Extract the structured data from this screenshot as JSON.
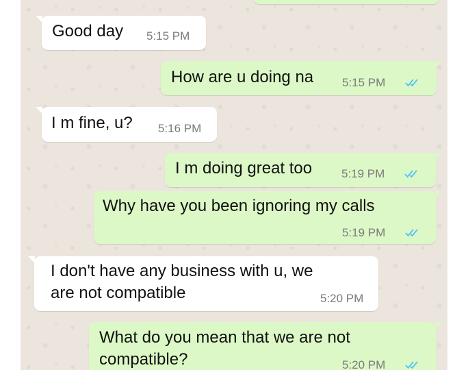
{
  "colors": {
    "chat_background": "#ece5dd",
    "incoming_bubble": "#ffffff",
    "outgoing_bubble": "#dcf8c6",
    "read_receipt": "#4fc3f7",
    "timestamp": "#7b7b7b"
  },
  "messages": [
    {
      "direction": "incoming",
      "text": "Good day",
      "time": "5:15 PM"
    },
    {
      "direction": "outgoing",
      "text": "How are u doing na",
      "time": "5:15 PM",
      "status_icon": "double-check-read-icon"
    },
    {
      "direction": "incoming",
      "text": "I m fine, u?",
      "time": "5:16 PM"
    },
    {
      "direction": "outgoing",
      "text": "I m doing great too",
      "time": "5:19 PM",
      "status_icon": "double-check-read-icon"
    },
    {
      "direction": "outgoing",
      "text": "Why have you been ignoring my calls",
      "time": "5:19 PM",
      "status_icon": "double-check-read-icon"
    },
    {
      "direction": "incoming",
      "lines": [
        "I don't have any business with u, we",
        "are not compatible"
      ],
      "time": "5:20 PM"
    },
    {
      "direction": "outgoing",
      "lines": [
        "What do you mean that we are not",
        "compatible?"
      ],
      "time": "5:20 PM",
      "status_icon": "double-check-read-icon"
    }
  ]
}
